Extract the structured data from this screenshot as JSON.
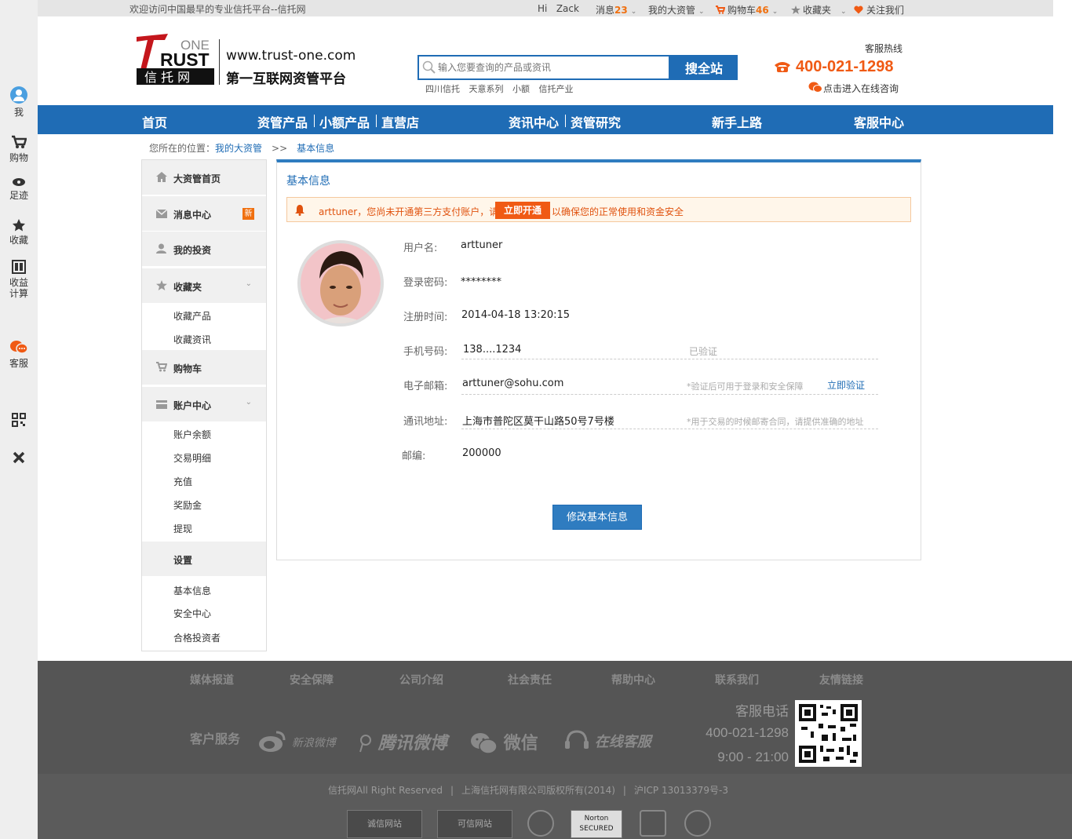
{
  "left_bar": {
    "items": [
      {
        "label": "我"
      },
      {
        "label": "购物"
      },
      {
        "label": "足迹"
      },
      {
        "label": "收藏"
      },
      {
        "label": "收益计算"
      },
      {
        "label": "客服"
      }
    ]
  },
  "topbar": {
    "welcome": "欢迎访问中国最早的专业信托平台--信托网",
    "greeting": "Hi",
    "username": "Zack",
    "messages_label": "消息",
    "messages_count": "23",
    "my_asset": "我的大资管",
    "cart_label": "购物车",
    "cart_count": "46",
    "favorites": "收藏夹",
    "follow": "关注我们"
  },
  "header": {
    "logo_one": "ONE",
    "logo_rust": "RUST",
    "logo_cn": "信 托 网",
    "url": "www.trust-one.com",
    "slogan": "第一互联网资管平台",
    "search_placeholder": "输入您要查询的产品或资讯",
    "search_button": "搜全站",
    "hot_words": [
      "四川信托",
      "天意系列",
      "小额",
      "信托产业"
    ],
    "hotline_label": "客服热线",
    "hotline_number": "400-021-1298",
    "online_consult": "点击进入在线咨询"
  },
  "nav": {
    "home": "首页",
    "products": "资管产品",
    "small": "小额产品",
    "store": "直营店",
    "news": "资讯中心",
    "research": "资管研究",
    "newbie": "新手上路",
    "service": "客服中心"
  },
  "breadcrumb": {
    "prefix": "您所在的位置：",
    "parent": "我的大资管",
    "arrow": ">>",
    "current": "基本信息"
  },
  "sidebar": {
    "home": "大资管首页",
    "messages": "消息中心",
    "new_badge": "新",
    "investments": "我的投资",
    "favorites": "收藏夹",
    "fav_products": "收藏产品",
    "fav_news": "收藏资讯",
    "cart": "购物车",
    "account": "账户中心",
    "balance": "账户余额",
    "transactions": "交易明细",
    "recharge": "充值",
    "bonus": "奖励金",
    "withdraw": "提现",
    "settings": "设置",
    "basic_info": "基本信息",
    "security": "安全中心",
    "qualified": "合格投资者"
  },
  "panel": {
    "title": "基本信息",
    "alert_text": "arttuner，您尚未开通第三方支付账户，请",
    "alert_button": "立即开通",
    "alert_text2": "以确保您的正常使用和资金安全",
    "fields": {
      "username_label": "用户名:",
      "username_value": "arttuner",
      "password_label": "登录密码:",
      "password_value": "********",
      "register_label": "注册时间:",
      "register_value": "2014-04-18  13:20:15",
      "phone_label": "手机号码:",
      "phone_value": "138....1234",
      "phone_hint": "已验证",
      "email_label": "电子邮箱:",
      "email_value": "arttuner@sohu.com",
      "email_hint": "*验证后可用于登录和安全保障",
      "email_verify": "立即验证",
      "address_label": "通讯地址:",
      "address_value": "上海市普陀区莫干山路50号7号楼",
      "address_hint": "*用于交易的时候邮寄合同，请提供准确的地址",
      "zip_label": "邮编:",
      "zip_value": "200000"
    },
    "edit_button": "修改基本信息"
  },
  "footer": {
    "links": [
      "媒体报道",
      "安全保障",
      "公司介绍",
      "社会责任",
      "帮助中心",
      "联系我们",
      "友情链接"
    ],
    "service_label": "客户服务",
    "weibo_sina": "新浪微博",
    "weibo_tencent": "腾讯微博",
    "wechat": "微信",
    "online_service": "在线客服",
    "phone_label": "客服电话",
    "phone_number": "400-021-1298",
    "hours": "9:00 - 21:00",
    "copyright": "信托网All Right Reserved",
    "company": "上海信托网有限公司版权所有(2014)",
    "icp": "沪ICP 13013379号-3",
    "badges": {
      "credit": "诚信网站",
      "trusted": "可信网站",
      "norton": "Norton SECURED"
    }
  }
}
